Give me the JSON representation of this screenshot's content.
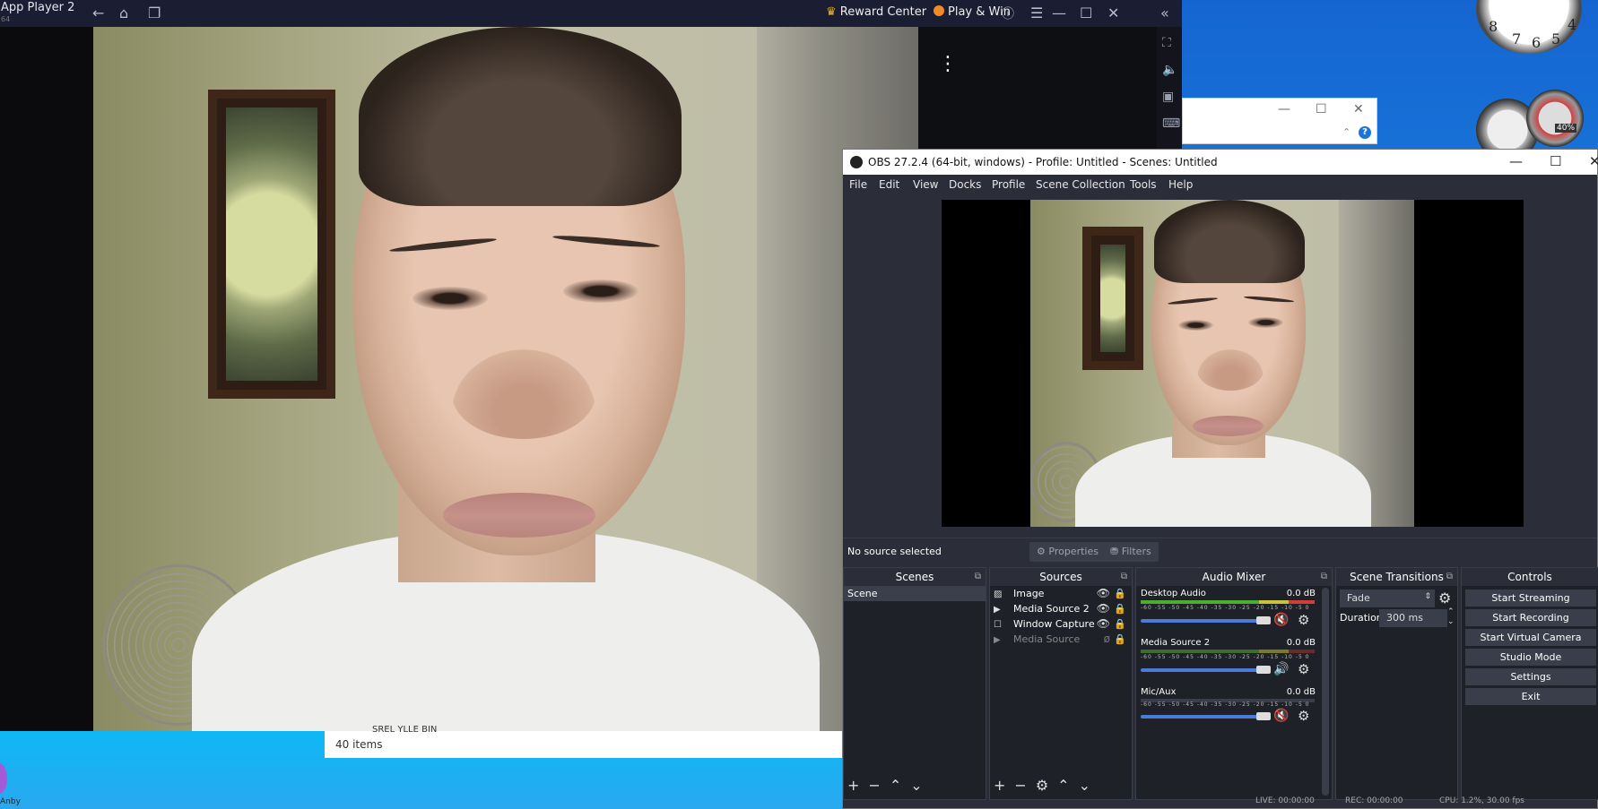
{
  "app": {
    "title": "App Player 2",
    "subtitle": "64",
    "reward_center": "Reward Center",
    "play_win": "Play & Win"
  },
  "explorer": {
    "count": "40 items",
    "clipped_name": "SREL YLLE BIN"
  },
  "desktop": {
    "taskbar_label": "Anby",
    "gauge_percent": "40%"
  },
  "obs": {
    "title": "OBS 27.2.4 (64-bit, windows) - Profile: Untitled - Scenes: Untitled",
    "menu": [
      "File",
      "Edit",
      "View",
      "Docks",
      "Profile",
      "Scene Collection",
      "Tools",
      "Help"
    ],
    "context": {
      "no_source": "No source selected",
      "properties": "Properties",
      "filters": "Filters"
    },
    "scenes": {
      "header": "Scenes",
      "items": [
        "Scene"
      ]
    },
    "sources": {
      "header": "Sources",
      "items": [
        "Image",
        "Media Source 2",
        "Window Capture",
        "Media Source"
      ]
    },
    "mixer": {
      "header": "Audio Mixer",
      "channels": [
        {
          "name": "Desktop Audio",
          "db": "0.0 dB",
          "muted": true
        },
        {
          "name": "Media Source 2",
          "db": "0.0 dB",
          "muted": false
        },
        {
          "name": "Mic/Aux",
          "db": "0.0 dB",
          "muted": true
        }
      ],
      "ticks": "-60 -55 -50 -45 -40 -35 -30 -25 -20 -15 -10 -5 0"
    },
    "transitions": {
      "header": "Scene Transitions",
      "selected": "Fade",
      "duration_label": "Duration",
      "duration_value": "300 ms"
    },
    "controls": {
      "header": "Controls",
      "buttons": [
        "Start Streaming",
        "Start Recording",
        "Start Virtual Camera",
        "Studio Mode",
        "Settings",
        "Exit"
      ]
    },
    "status": {
      "live": "LIVE: 00:00:00",
      "rec": "REC: 00:00:00",
      "cpu": "CPU: 1.2%, 30.00 fps"
    }
  }
}
